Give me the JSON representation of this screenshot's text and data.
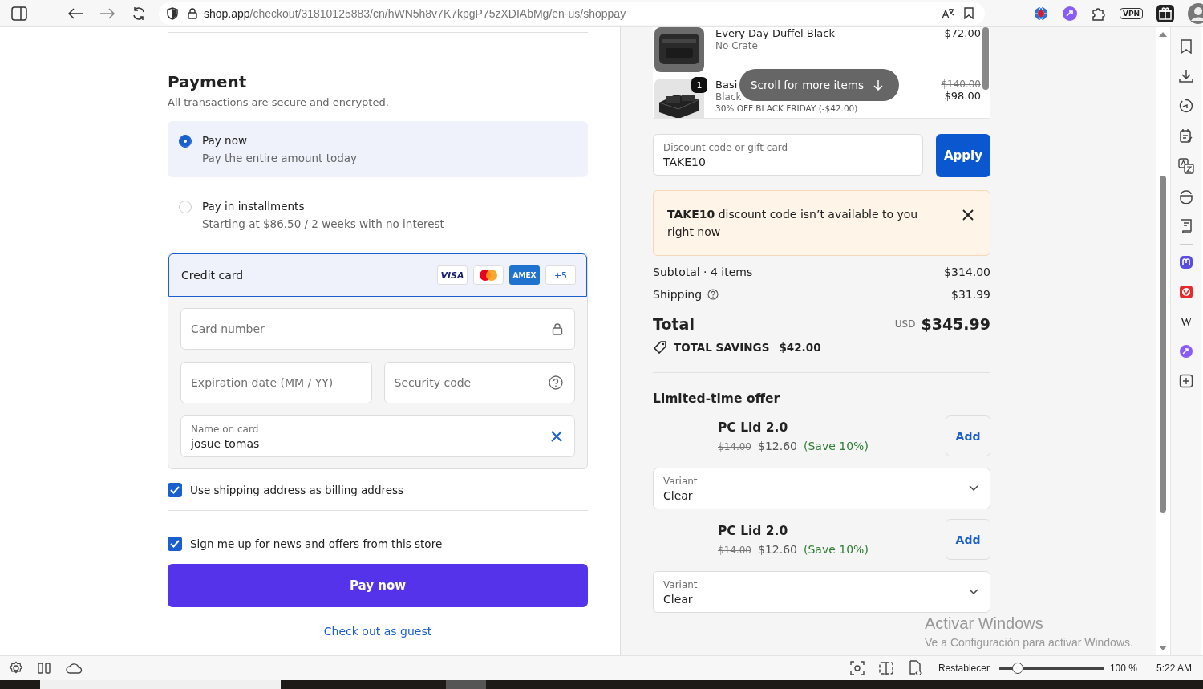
{
  "browser": {
    "url_host": "shop.app",
    "url_path": "/checkout/31810125883/cn/hWN5h8v7K7kpgP75zXDIAbMg/en-us/shoppay",
    "vpn_label": "VPN"
  },
  "payment": {
    "title": "Payment",
    "subtitle": "All transactions are secure and encrypted.",
    "options": [
      {
        "label": "Pay now",
        "detail": "Pay the entire amount today",
        "selected": true
      },
      {
        "label": "Pay in installments",
        "detail": "Starting at $86.50 / 2 weeks with no interest",
        "selected": false
      }
    ],
    "card": {
      "label": "Credit card",
      "brands": [
        {
          "kind": "visa",
          "label": "VISA"
        },
        {
          "kind": "mastercard"
        },
        {
          "kind": "amex",
          "label": "AMEX"
        },
        {
          "kind": "more",
          "label": "+5"
        }
      ],
      "card_number": {
        "placeholder": "Card number"
      },
      "expiration": {
        "placeholder": "Expiration date (MM / YY)"
      },
      "security_code": {
        "placeholder": "Security code"
      },
      "name_on_card": {
        "label": "Name on card",
        "value": "josue tomas"
      }
    },
    "checkboxes": [
      {
        "label": "Use shipping address as billing address",
        "checked": true
      },
      {
        "label": "Sign me up for news and offers from this store",
        "checked": true
      }
    ],
    "pay_button": "Pay now",
    "guest_link": "Check out as guest"
  },
  "summary": {
    "items": [
      {
        "name": "Every Day Duffel Black",
        "variant": "No Crate",
        "price": "$72.00"
      },
      {
        "name": "Basi",
        "variant": "Black",
        "discount": "30% OFF BLACK FRIDAY (-$42.00)",
        "old_price": "$140.00",
        "price": "$98.00",
        "badge": "1"
      }
    ],
    "scroll_hint": "Scroll for more items",
    "discount": {
      "label": "Discount code or gift card",
      "value": "TAKE10"
    },
    "apply": "Apply",
    "alert": "**TAKE10** discount code isn’t available to you right now",
    "subtotal_label": "Subtotal · 4 items",
    "subtotal": "$314.00",
    "shipping_label": "Shipping",
    "shipping": "$31.99",
    "total_label": "Total",
    "currency": "USD",
    "total": "$345.99",
    "savings_label": "TOTAL SAVINGS",
    "savings": "$42.00",
    "offer_title": "Limited-time offer",
    "offers": [
      {
        "name": "PC Lid 2.0",
        "old_price": "$14.00",
        "price": "$12.60",
        "save": "(Save 10%)",
        "add": "Add",
        "variant_label": "Variant",
        "variant": "Clear"
      },
      {
        "name": "PC Lid 2.0",
        "old_price": "$14.00",
        "price": "$12.60",
        "save": "(Save 10%)",
        "add": "Add",
        "variant_label": "Variant",
        "variant": "Clear"
      }
    ]
  },
  "side_panel": {
    "wikipedia_label": "W"
  },
  "status_bar": {
    "reset": "Restablecer",
    "zoom": {
      "level": 0.18
    },
    "zoom_reading": "100 %",
    "time": "5:22 AM"
  },
  "watermark": {
    "title": "Activar Windows",
    "detail": "Ve a Configuración para activar Windows."
  }
}
